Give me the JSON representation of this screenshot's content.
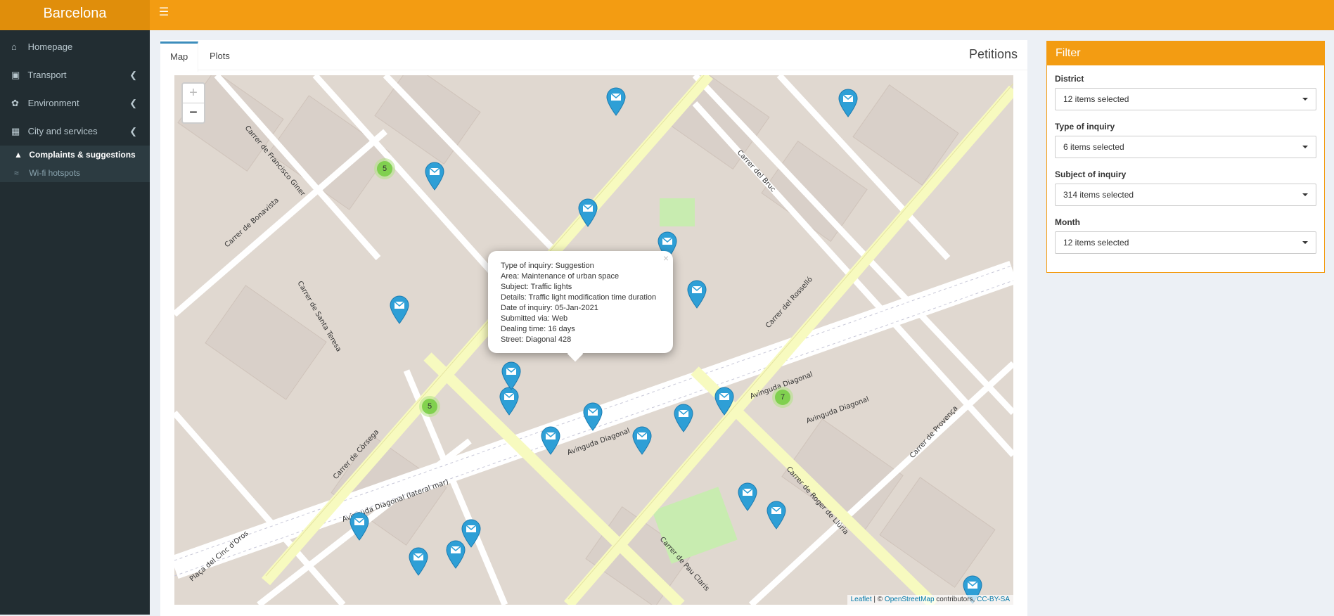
{
  "app": {
    "title": "Barcelona",
    "menu_icon": "hamburger-icon"
  },
  "sidebar": {
    "items": [
      {
        "label": "Homepage",
        "icon": "home-icon"
      },
      {
        "label": "Transport",
        "icon": "bus-icon"
      },
      {
        "label": "Environment",
        "icon": "leaf-icon"
      },
      {
        "label": "City and services",
        "icon": "building-icon"
      }
    ],
    "subitems": [
      {
        "label": "Complaints & suggestions",
        "icon": "inbox-icon",
        "active": true
      },
      {
        "label": "Wi-fi hotspots",
        "icon": "wifi-icon",
        "active": false
      }
    ]
  },
  "main": {
    "tabs": [
      "Map",
      "Plots"
    ],
    "active_tab": "Map",
    "title": "Petitions"
  },
  "map": {
    "zoom_in": "+",
    "zoom_out": "−",
    "popup": {
      "close": "×",
      "lines": [
        "Type of inquiry: Suggestion",
        "Area: Maintenance of urban space",
        "Subject: Traffic lights",
        "Details: Traffic light modification time duration",
        "Date of inquiry: 05-Jan-2021",
        "Submitted via: Web",
        "Dealing time: 16 days",
        "Street: Diagonal 428"
      ]
    },
    "clusters": [
      "5",
      "5",
      "7"
    ],
    "street_labels": [
      "Carrer de Còrsega",
      "Avinguda Diagonal",
      "Carrer de Roger de Llúria",
      "Carrer del Rosselló",
      "Carrer de Pau Claris",
      "Carrer de Provença",
      "Carrer del Bruc",
      "Carrer de Santa Teresa",
      "Carrer de Bonavista",
      "Carrer de Francisco Giner",
      "Plaça del Cinc d'Oros",
      "Avinguda Diagonal (lateral mar)"
    ],
    "attribution": {
      "leaflet": "Leaflet",
      "sep": " | © ",
      "osm": "OpenStreetMap",
      "contrib": " contributors, ",
      "license": "CC-BY-SA"
    }
  },
  "filter": {
    "title": "Filter",
    "fields": [
      {
        "label": "District",
        "value": "12 items selected"
      },
      {
        "label": "Type of inquiry",
        "value": "6 items selected"
      },
      {
        "label": "Subject of inquiry",
        "value": "314 items selected"
      },
      {
        "label": "Month",
        "value": "12 items selected"
      }
    ]
  },
  "colors": {
    "header": "#f39c12",
    "logo": "#e08e0b",
    "sidebar": "#222d32",
    "marker": "#2e9fd6",
    "cluster": "#6ecc39"
  }
}
